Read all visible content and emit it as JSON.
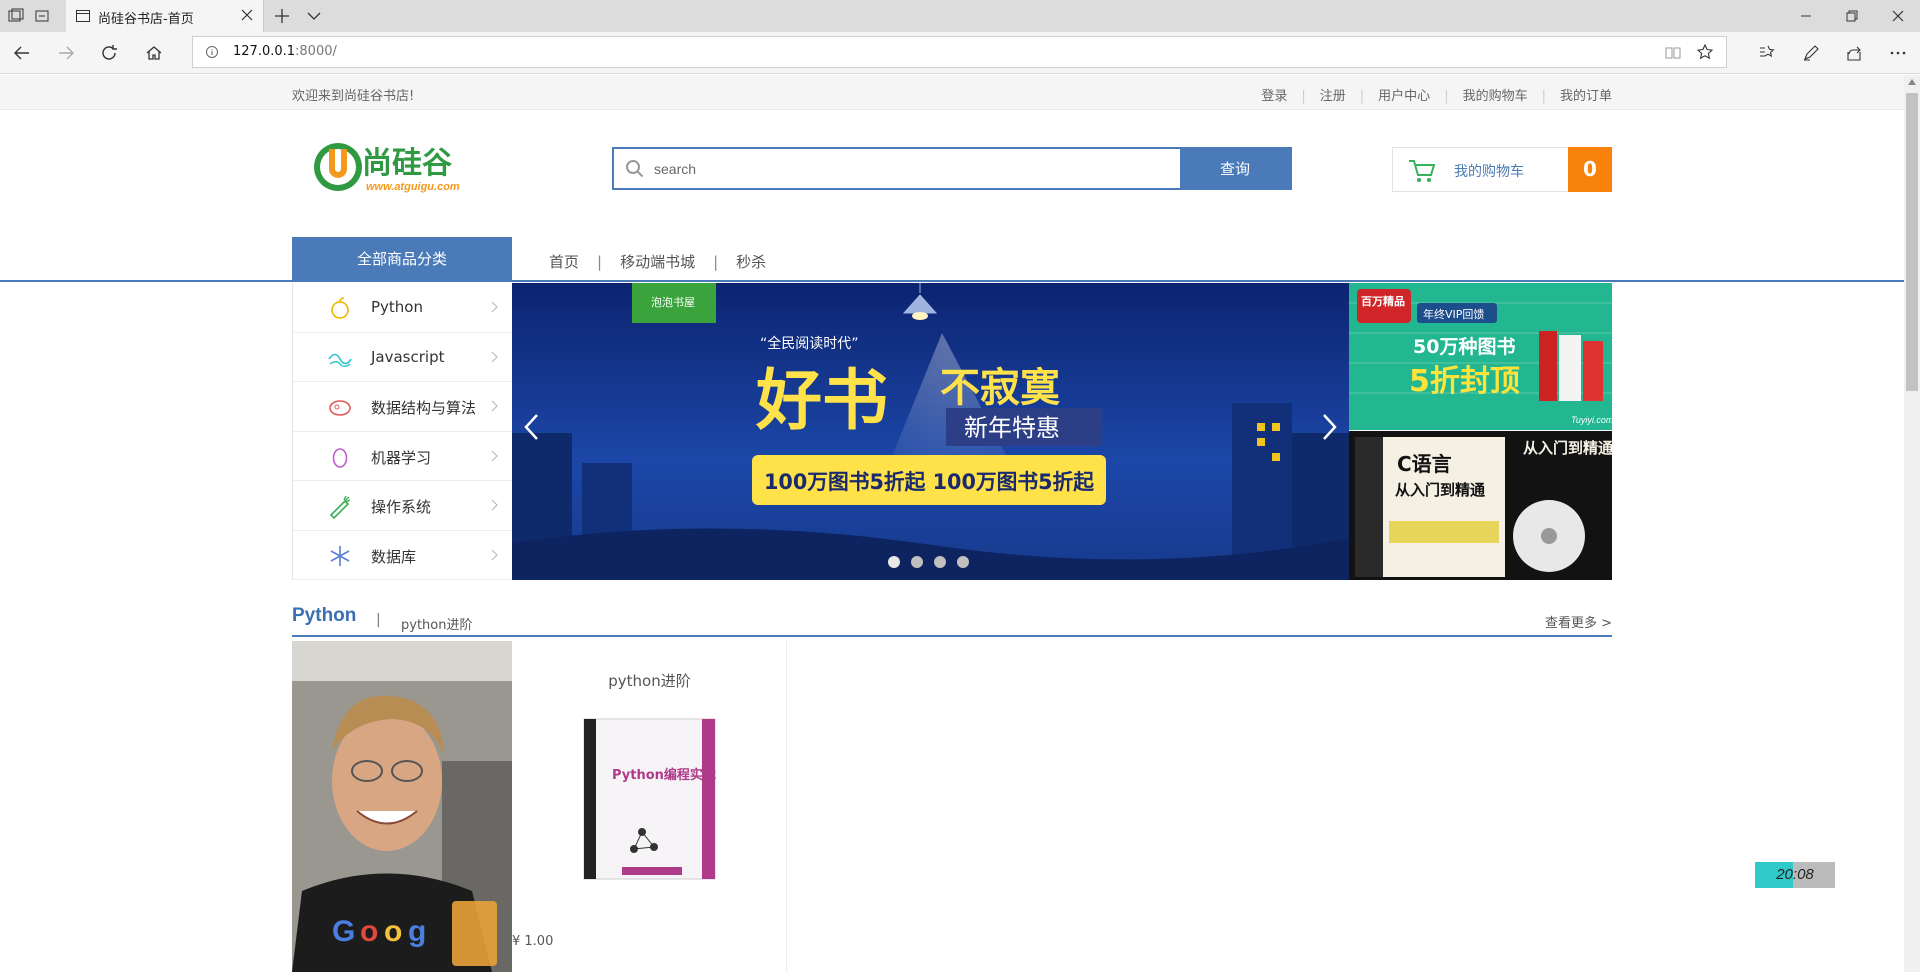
{
  "browser": {
    "tab_title": "尚硅谷书店-首页",
    "url_host": "127.0.0.1",
    "url_path": ":8000/"
  },
  "topbar": {
    "welcome": "欢迎来到尚硅谷书店!",
    "links": [
      "登录",
      "注册",
      "用户中心",
      "我的购物车",
      "我的订单"
    ]
  },
  "header": {
    "logo_text": "尚硅谷",
    "logo_url_text": "www.atguigu.com",
    "search_placeholder": "search",
    "search_button": "查询",
    "cart_label": "我的购物车",
    "cart_count": "0"
  },
  "nav": {
    "all_categories": "全部商品分类",
    "items": [
      "首页",
      "移动端书城",
      "秒杀"
    ],
    "sep": "|"
  },
  "categories": [
    "Python",
    "Javascript",
    "数据结构与算法",
    "机器学习",
    "操作系统",
    "数据库"
  ],
  "banner": {
    "tag": "泡泡书屋",
    "quote": "“全民阅读时代”",
    "headline_big": "好书",
    "headline_small": "不寂寞",
    "subtitle": "新年特惠",
    "promo": "100万图书5折起 100万图书5折起",
    "slides": 4,
    "active_slide": 0
  },
  "ads": {
    "ad1_badge": "百万精品",
    "ad1_tag": "年终VIP回馈",
    "ad1_line1": "50万种图书",
    "ad1_line2": "5折封顶",
    "ad1_site": "Tuyiyi.com",
    "ad2_title": "C语言",
    "ad2_sub": "从入门到精通"
  },
  "section": {
    "title": "Python",
    "sep": "|",
    "subtitle": "python进阶",
    "more": "查看更多 >"
  },
  "product": {
    "name": "python进阶",
    "cover_title": "Python编程实战",
    "price": "¥ 1.00"
  },
  "clock": "20:08",
  "colors": {
    "accent": "#4a7ab8",
    "cart_orange": "#f8820b",
    "logo_green": "#2f9a42",
    "logo_orange": "#f39a1e"
  }
}
